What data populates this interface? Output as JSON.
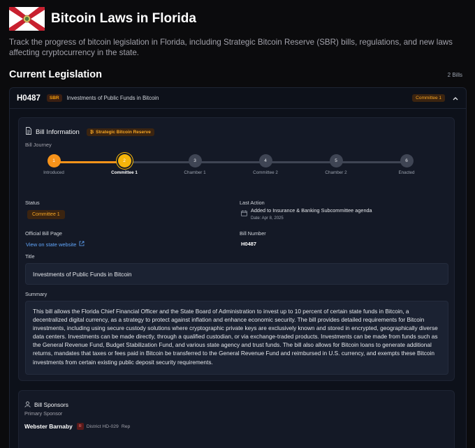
{
  "header": {
    "title": "Bitcoin Laws in Florida",
    "flag_icon": "florida-flag-icon",
    "description": "Track the progress of bitcoin legislation in Florida, including Strategic Bitcoin Reserve (SBR) bills, regulations, and new laws affecting cryptocurrency in the state."
  },
  "section": {
    "title": "Current Legislation",
    "count": "2 Bills"
  },
  "bill": {
    "id": "H0487",
    "tag": "SBR",
    "short_title": "Investments of Public Funds in Bitcoin",
    "status_tag": "Committee 1",
    "info": {
      "heading": "Bill Information",
      "reserve_tag": "Strategic Bitcoin Reserve",
      "journey_label": "Bill Journey",
      "steps": [
        {
          "num": "1",
          "label": "Introduced"
        },
        {
          "num": "2",
          "label": "Committee 1"
        },
        {
          "num": "3",
          "label": "Chamber 1"
        },
        {
          "num": "4",
          "label": "Committee 2"
        },
        {
          "num": "5",
          "label": "Chamber 2"
        },
        {
          "num": "6",
          "label": "Enacted"
        }
      ],
      "current_step": 2,
      "status_label": "Status",
      "status_value": "Committee 1",
      "last_action_label": "Last Action",
      "last_action_text": "Added to Insurance & Banking Subcommittee agenda",
      "last_action_date": "Date: Apr 8, 2025",
      "official_page_label": "Official Bill Page",
      "official_page_link": "View on state website",
      "bill_number_label": "Bill Number",
      "bill_number_value": "H0487",
      "title_label": "Title",
      "title_value": "Investments of Public Funds in Bitcoin",
      "summary_label": "Summary",
      "summary_value": "This bill allows the Florida Chief Financial Officer and the State Board of Administration to invest up to 10 percent of certain state funds in Bitcoin, a decentralized digital currency, as a strategy to protect against inflation and enhance economic security. The bill provides detailed requirements for Bitcoin investments, including using secure custody solutions where cryptographic private keys are exclusively known and stored in encrypted, geographically diverse data centers. Investments can be made directly, through a qualified custodian, or via exchange-traded products. Investments can be made from funds such as the General Revenue Fund, Budget Stabilization Fund, and various state agency and trust funds. The bill also allows for Bitcoin loans to generate additional returns, mandates that taxes or fees paid in Bitcoin be transferred to the General Revenue Fund and reimbursed in U.S. currency, and exempts these Bitcoin investments from certain existing public deposit security requirements."
    },
    "sponsors": {
      "heading": "Bill Sponsors",
      "primary_label": "Primary Sponsor",
      "name": "Webster Barnaby",
      "party": "R",
      "district": "District HD-029",
      "role": "Rep"
    }
  },
  "colors": {
    "accent": "#f7931a",
    "current": "#f5b50b",
    "link": "#60a5fa"
  }
}
